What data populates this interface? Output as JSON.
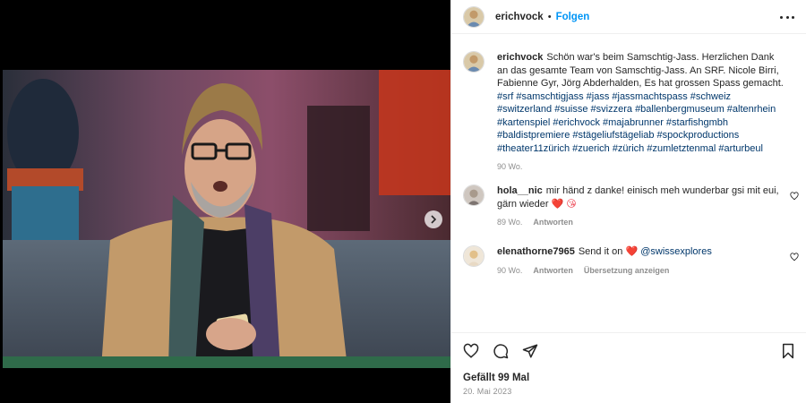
{
  "post": {
    "username": "erichvock",
    "separator": "•",
    "follow_label": "Folgen"
  },
  "caption": {
    "username": "erichvock",
    "text": "Schön war's beim Samschtig-Jass. Herzlichen Dank an das gesamte Team von Samschtig-Jass. An SRF. Nicole Birri, Fabienne Gyr, Jörg Abderhalden, Es hat grossen Spass gemacht.",
    "hashtags": "#srf #samschtigjass #jass #jassmachtspass #schweiz #switzerland #suisse #svizzera #ballenbergmuseum #altenrhein #kartenspiel #erichvock #majabrunner #starfishgmbh #baldistpremiere #stägeliufstägeliab #spockproductions #theater11zürich #zuerich #zürich #zumletztenmal #arturbeul",
    "time": "90 Wo."
  },
  "comments": [
    {
      "username": "hola__nic",
      "text": "mir händ z danke! einisch meh wunderbar gsi mit eui, gärn wieder",
      "emoji": "❤️ 😘",
      "time": "89 Wo.",
      "reply_label": "Antworten"
    },
    {
      "username": "elenathorne7965",
      "text": "Send it on",
      "emoji": "❤️",
      "mention": "@swissexplores",
      "time": "90 Wo.",
      "reply_label": "Antworten",
      "translate_label": "Übersetzung anzeigen"
    }
  ],
  "footer": {
    "likes": "Gefällt 99 Mal",
    "date": "20. Mai 2023"
  },
  "icons": {
    "like": "heart-icon",
    "comment": "comment-icon",
    "share": "share-icon",
    "save": "bookmark-icon",
    "more": "more-icon",
    "next": "chevron-right-icon"
  },
  "colors": {
    "link": "#00376b",
    "follow": "#0095f6",
    "heart": "#ed4956",
    "muted": "#8e8e8e"
  }
}
